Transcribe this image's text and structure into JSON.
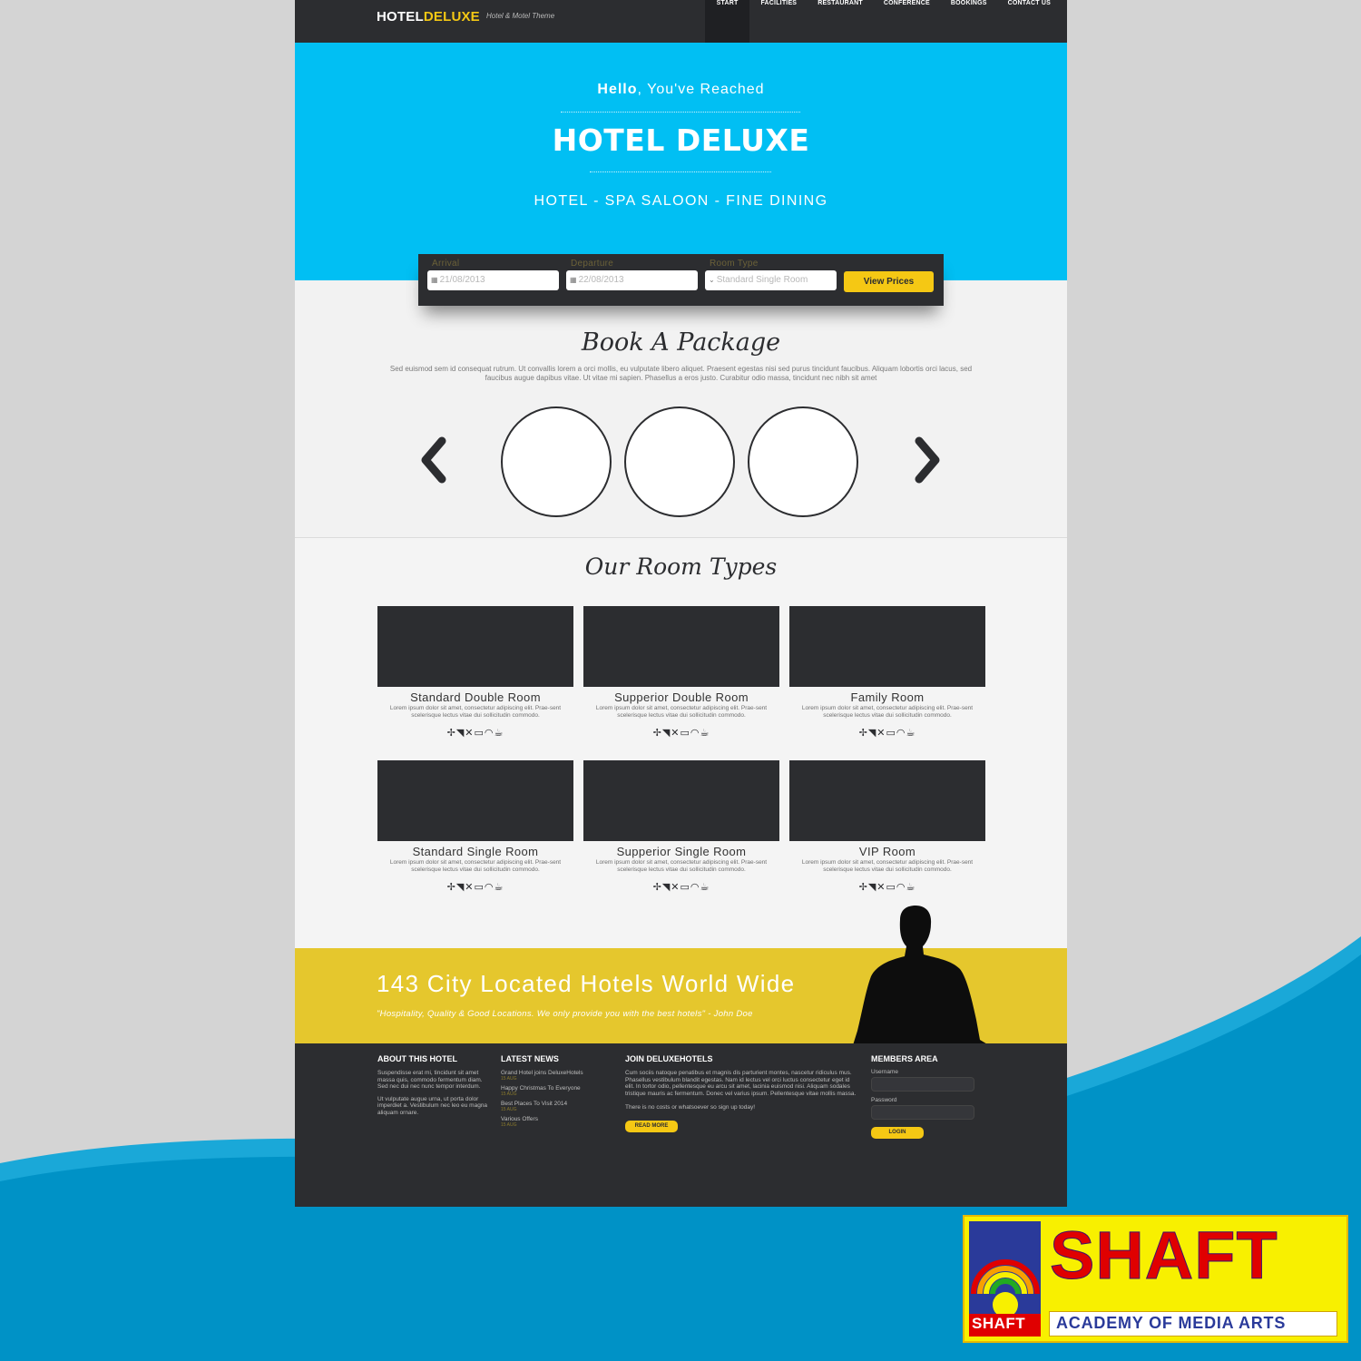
{
  "header": {
    "logo_part1": "HOTEL",
    "logo_part2": "DELUXE",
    "tagline": "Hotel & Motel Theme",
    "nav": [
      "START",
      "FACILITIES",
      "RESTAURANT",
      "CONFERENCE",
      "BOOKINGS",
      "CONTACT US"
    ]
  },
  "hero": {
    "hello_bold": "Hello",
    "hello_rest": ", You've Reached",
    "title": "HOTEL DELUXE",
    "subtitle": "HOTEL - SPA SALOON - FINE DINING"
  },
  "booking": {
    "arrival_label": "Arrival",
    "arrival_value": "21/08/2013",
    "departure_label": "Departure",
    "departure_value": "22/08/2013",
    "room_label": "Room Type",
    "room_value": "Standard Single Room",
    "button": "View Prices"
  },
  "package": {
    "title": "Book A Package",
    "desc": "Sed euismod sem id consequat rutrum. Ut convallis lorem a orci mollis, eu vulputate libero aliquet. Praesent egestas nisi sed purus tincidunt faucibus. Aliquam lobortis orci lacus, sed faucibus augue dapibus vitae. Ut vitae mi sapien. Phasellus a eros justo. Curabitur odio massa, tincidunt nec nibh sit amet"
  },
  "rooms": {
    "title": "Our Room Types",
    "items": [
      {
        "name": "Standard Double Room",
        "desc": "Lorem ipsum dolor sit amet, consectetur adipiscing elit. Prae-sent scelerisque lectus vitae dui sollicitudin commodo."
      },
      {
        "name": "Supperior Double Room",
        "desc": "Lorem ipsum dolor sit amet, consectetur adipiscing elit. Prae-sent scelerisque lectus vitae dui sollicitudin commodo."
      },
      {
        "name": "Family Room",
        "desc": "Lorem ipsum dolor sit amet, consectetur adipiscing elit. Prae-sent scelerisque lectus vitae dui sollicitudin commodo."
      },
      {
        "name": "Standard Single Room",
        "desc": "Lorem ipsum dolor sit amet, consectetur adipiscing elit. Prae-sent scelerisque lectus vitae dui sollicitudin commodo."
      },
      {
        "name": "Supperior Single Room",
        "desc": "Lorem ipsum dolor sit amet, consectetur adipiscing elit. Prae-sent scelerisque lectus vitae dui sollicitudin commodo."
      },
      {
        "name": "VIP Room",
        "desc": "Lorem ipsum dolor sit amet, consectetur adipiscing elit. Prae-sent scelerisque lectus vitae dui sollicitudin commodo."
      }
    ],
    "amenity_icons": [
      "fan-icon",
      "hairdryer-icon",
      "ironing-icon",
      "tv-icon",
      "wifi-icon",
      "coffee-icon"
    ]
  },
  "banner": {
    "title": "143 City  Located Hotels World Wide",
    "quote": "\"Hospitality, Quality & Good Locations. We only provide you with the best hotels\" - John Doe"
  },
  "footer": {
    "about_title": "ABOUT THIS HOTEL",
    "about_p1": "Suspendisse erat mi, tincidunt sit amet massa quis, commodo fermentum diam. Sed nec dui nec nunc tempor interdum.",
    "about_p2": "Ut vulputate augue urna, ut porta dolor imperdiet a. Vestibulum nec leo eu magna aliquam ornare.",
    "news_title": "LATEST NEWS",
    "news": [
      {
        "title": "Grand Hotel joins DeluxeHotels",
        "date": "15 AUG"
      },
      {
        "title": "Happy Christmas To Everyone",
        "date": "15 AUG"
      },
      {
        "title": "Best Places To Visit 2014",
        "date": "15 AUG"
      },
      {
        "title": "Various Offers",
        "date": "15 AUG"
      }
    ],
    "join_title": "JOIN DELUXEHOTELS",
    "join_p1": "Cum sociis natoque penatibus et magnis dis parturient montes, nascetur ridiculus mus. Phasellus vestibulum blandit egestas. Nam id lectus vel orci luctus consectetur eget id elit. In tortor odio, pellentesque eu arcu sit amet, lacinia euismod nisi. Aliquam sodales tristique mauris ac fermentum. Donec vel varius ipsum. Pellentesque vitae mollis massa.",
    "join_p2": "There is no costs or whatsoever so sign up today!",
    "read_more": "READ MORE",
    "members_title": "MEMBERS AREA",
    "username_label": "Username",
    "password_label": "Password",
    "login": "LOGIN"
  },
  "brand": {
    "name": "SHAFT",
    "small": "SHAFT",
    "subtitle": "ACADEMY OF MEDIA ARTS"
  },
  "colors": {
    "accent_blue": "#01bff3",
    "accent_yellow": "#f5c814",
    "banner_yellow": "#e5c72d",
    "dark": "#2c2d30"
  }
}
